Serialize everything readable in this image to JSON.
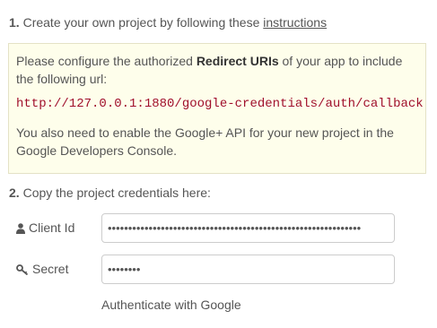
{
  "step1": {
    "number": "1.",
    "text": "Create your own project by following these",
    "link": "instructions"
  },
  "info": {
    "para1_prefix": "Please configure the authorized",
    "para1_bold": "Redirect URIs",
    "para1_suffix": "of your app to include the following url:",
    "redirect_url": "http://127.0.0.1:1880/google-credentials/auth/callback",
    "para2": "You also need to enable the Google+ API for your new project in the Google Developers Console."
  },
  "step2": {
    "number": "2.",
    "text": "Copy the project credentials here:"
  },
  "form": {
    "client_label": "Client Id",
    "client_value": "••••••••••••••••••••••••••••••••••••••••••••••••••••••••••••••",
    "secret_label": "Secret",
    "secret_value": "••••••••",
    "auth_button": "Authenticate with Google"
  },
  "icons": {
    "client": "user-icon",
    "secret": "key-icon"
  },
  "colors": {
    "info_background": "#fefeeb",
    "url_color": "#a00f2c"
  }
}
